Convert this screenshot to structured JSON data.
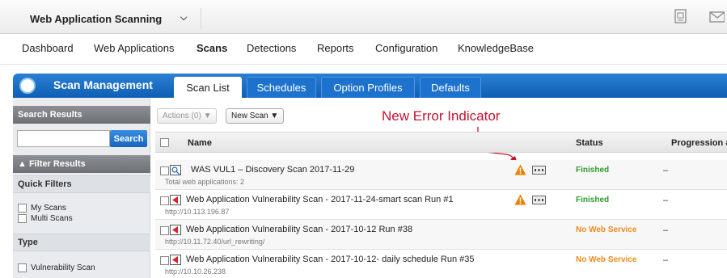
{
  "header": {
    "app_name": "Web Application Scanning",
    "chevron_icon": "chevron-down-icon",
    "right_icons": [
      "notes-icon",
      "mail-icon"
    ]
  },
  "nav": {
    "items": [
      {
        "label": "Dashboard",
        "active": false
      },
      {
        "label": "Web Applications",
        "active": false
      },
      {
        "label": "Scans",
        "active": true
      },
      {
        "label": "Detections",
        "active": false
      },
      {
        "label": "Reports",
        "active": false
      },
      {
        "label": "Configuration",
        "active": false
      },
      {
        "label": "KnowledgeBase",
        "active": false
      }
    ]
  },
  "module": {
    "title": "Scan Management",
    "tabs": [
      {
        "label": "Scan List",
        "active": true
      },
      {
        "label": "Schedules",
        "active": false
      },
      {
        "label": "Option Profiles",
        "active": false
      },
      {
        "label": "Defaults",
        "active": false
      }
    ]
  },
  "sidebar": {
    "search_header": "Search Results",
    "search_button": "Search",
    "search_value": "",
    "filter_header": "▲ Filter Results",
    "quick_filters_label": "Quick Filters",
    "quick_filters": [
      "My Scans",
      "Multi Scans"
    ],
    "type_label": "Type",
    "type_filters": [
      "Vulnerability Scan"
    ]
  },
  "toolbar": {
    "actions_label": "Actions (0) ▼",
    "new_scan_label": "New Scan ▼"
  },
  "annotation": "New Error Indicator",
  "table": {
    "columns": {
      "name": "Name",
      "status": "Status",
      "progression": "Progression #"
    },
    "rows": [
      {
        "name": "WAS VUL1 – Discovery Scan 2017-11-29",
        "sub": "Total web applications: 2",
        "status": "Finished",
        "status_color": "#2e9a2e",
        "progression": "–",
        "error": true,
        "multi": true
      },
      {
        "name": "Web Application Vulnerability Scan - 2017-11-24-smart scan Run #1",
        "sub": "http://10.113.196.87",
        "status": "Finished",
        "status_color": "#2e9a2e",
        "progression": "–",
        "error": true,
        "multi": false
      },
      {
        "name": "Web Application Vulnerability Scan - 2017-10-12 Run #38",
        "sub": "http://10.11.72.40/url_rewriting/",
        "status": "No Web Service",
        "status_color": "#f08a1c",
        "progression": "–",
        "error": false,
        "multi": false
      },
      {
        "name": "Web Application Vulnerability Scan - 2017-10-12- daily schedule Run #35",
        "sub": "http://10.10.26.238",
        "status": "No Web Service",
        "status_color": "#f08a1c",
        "progression": "–",
        "error": false,
        "multi": false
      }
    ]
  },
  "colors": {
    "accent_blue": "#1565c0",
    "error_orange": "#f07d00",
    "annotation_red": "#c8102e"
  }
}
